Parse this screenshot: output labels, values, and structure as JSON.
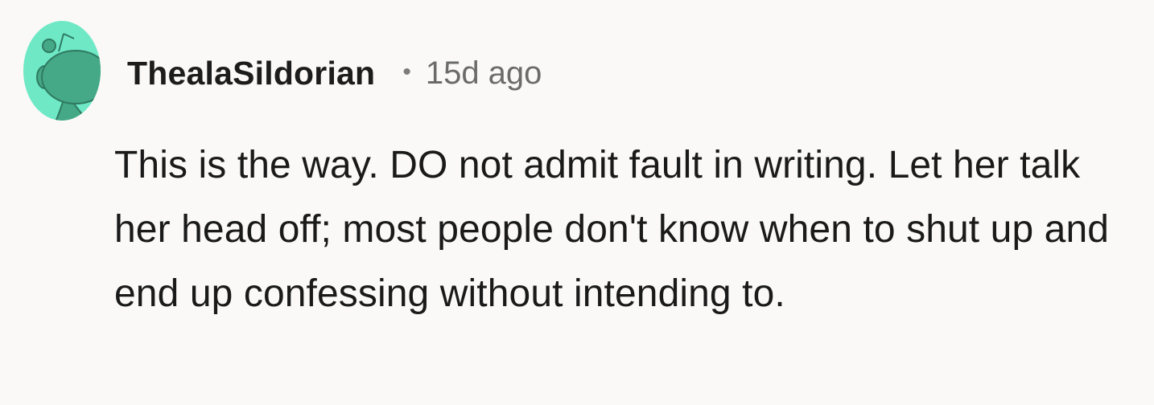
{
  "comment": {
    "author": "ThealaSildorian",
    "separator": "•",
    "time_ago": "15d ago",
    "body": "This is the way. DO not admit fault in writing. Let her talk her head off; most people don't know when to shut up and end up confessing without intending to.",
    "avatar_icon": "snoo-avatar-icon"
  },
  "colors": {
    "background": "#faf9f7",
    "avatar_bg": "#6ee8c5",
    "avatar_figure": "#45a886",
    "username": "#1c1c1c",
    "meta": "#6b6b6b",
    "body_text": "#1a1a1a"
  }
}
